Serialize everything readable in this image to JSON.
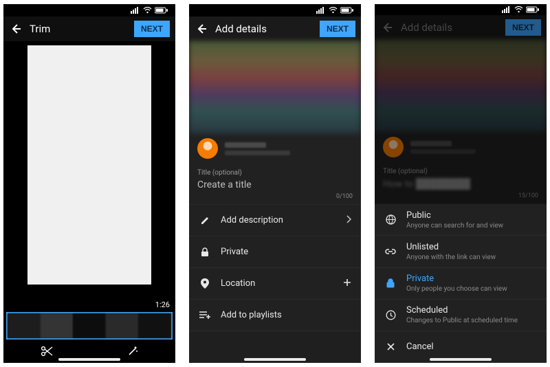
{
  "screen1": {
    "title": "Trim",
    "next": "NEXT",
    "duration": "1:26"
  },
  "screen2": {
    "title": "Add details",
    "next": "NEXT",
    "title_field_label": "Title (optional)",
    "title_placeholder": "Create a title",
    "title_counter": "0/100",
    "rows": {
      "description": "Add description",
      "private": "Private",
      "location": "Location",
      "playlists": "Add to playlists"
    }
  },
  "screen3": {
    "title": "Add details",
    "next": "NEXT",
    "title_field_label": "Title (optional)",
    "title_counter": "15/100",
    "options": {
      "public": {
        "label": "Public",
        "sub": "Anyone can search for and view"
      },
      "unlisted": {
        "label": "Unlisted",
        "sub": "Anyone with the link can view"
      },
      "private": {
        "label": "Private",
        "sub": "Only people you choose can view"
      },
      "scheduled": {
        "label": "Scheduled",
        "sub": "Changes to Public at scheduled time"
      },
      "cancel": {
        "label": "Cancel"
      }
    }
  }
}
